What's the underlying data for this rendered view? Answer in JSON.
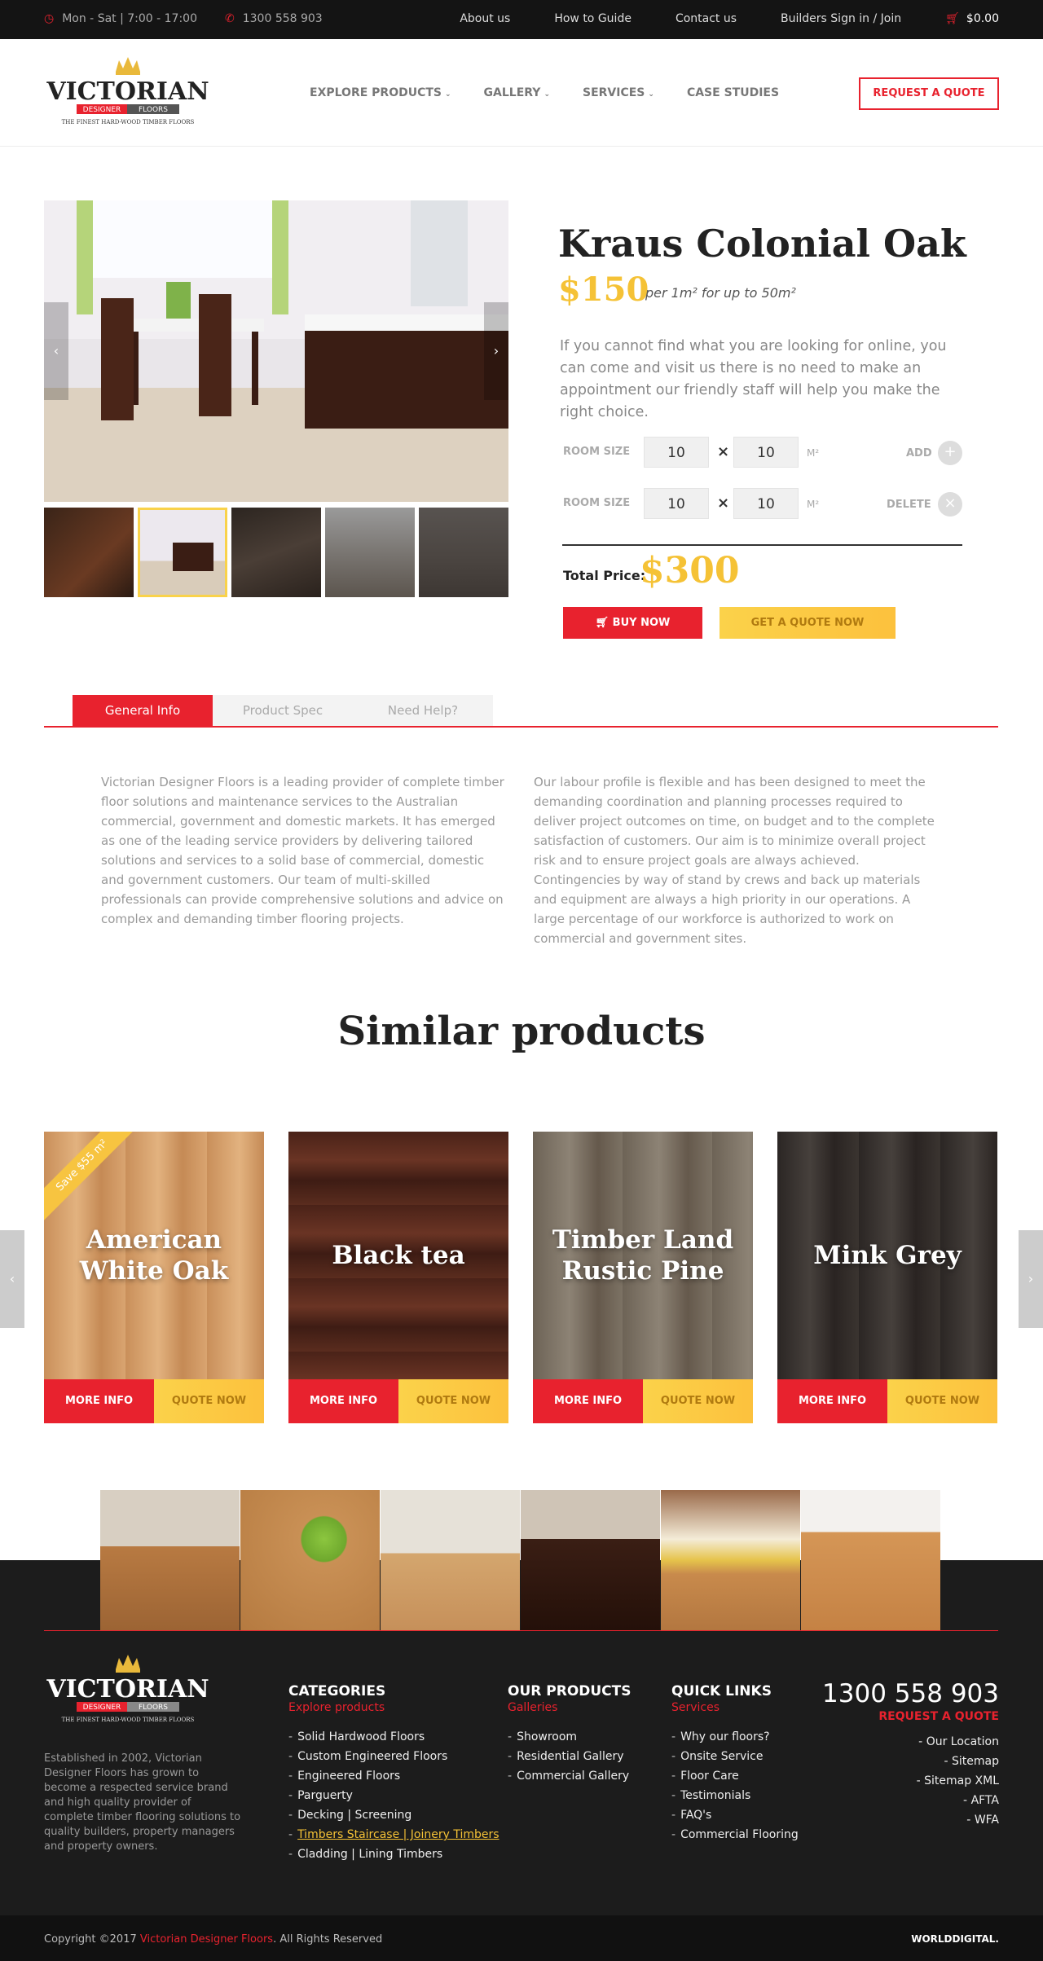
{
  "topbar": {
    "hours": "Mon - Sat | 7:00 - 17:00",
    "phone": "1300 558 903",
    "links": [
      "About us",
      "How to Guide",
      "Contact us",
      "Builders Sign in / Join"
    ],
    "cart": "$0.00"
  },
  "header": {
    "logo_main": "VICTORIAN",
    "logo_badge_a": "DESIGNER",
    "logo_badge_b": "FLOORS",
    "logo_tagline": "THE FINEST HARD-WOOD TIMBER FLOORS",
    "nav": [
      "EXPLORE PRODUCTS",
      "GALLERY",
      "SERVICES",
      "CASE STUDIES"
    ],
    "cta": "REQUEST A QUOTE"
  },
  "product": {
    "title": "Kraus Colonial Oak",
    "price": "$150",
    "per_unit": "per 1m² for up to 50m²",
    "description": "If you cannot find what you are looking for online, you can come and visit us there is no need to make an appointment our friendly staff will help you make the right choice.",
    "rows": [
      {
        "label": "ROOM SIZE",
        "a": "10",
        "b": "10",
        "unit": "M²",
        "action": "ADD",
        "symbol": "+"
      },
      {
        "label": "ROOM SIZE",
        "a": "10",
        "b": "10",
        "unit": "M²",
        "action": "DELETE",
        "symbol": "×"
      }
    ],
    "times": "×",
    "total_label": "Total Price:",
    "total": "$300",
    "buy": "BUY NOW",
    "quote": "GET A QUOTE NOW"
  },
  "tabs": [
    "General Info",
    "Product Spec",
    "Need Help?"
  ],
  "info": {
    "left": "Victorian Designer Floors is a leading provider of complete timber floor solutions and maintenance services to the Australian commercial, government and domestic markets. It has emerged as one of the leading service providers by delivering tailored solutions and services to a solid base of commercial, domestic and government customers. Our team of multi-skilled professionals can provide comprehensive solutions and advice on complex and demanding timber flooring projects.",
    "right": "Our labour profile is flexible and has been designed to meet the demanding coordination and planning processes required to deliver project outcomes on time, on budget and to the complete satisfaction of customers. Our aim is to minimize overall project risk and to ensure project goals are always achieved. Contingencies by way of stand by crews and back up materials and equipment are always a high priority in our operations. A large percentage of our workforce is authorized to work on commercial and government sites."
  },
  "similar": {
    "title": "Similar products",
    "ribbon": "Save $55 m²",
    "more": "MORE INFO",
    "quote": "QUOTE NOW",
    "cards": [
      {
        "name": "American White Oak",
        "color_a": "#c98f5a",
        "color_b": "#e2b27f"
      },
      {
        "name": "Black tea",
        "color_a": "#4a2218",
        "color_b": "#6a3424"
      },
      {
        "name": "Timber Land Rustic Pine",
        "color_a": "#6d6356",
        "color_b": "#8d8375"
      },
      {
        "name": "Mink Grey",
        "color_a": "#2b2624",
        "color_b": "#46403c"
      }
    ]
  },
  "footer": {
    "about": "Established in 2002, Victorian Designer Floors has grown to become a respected service brand and high quality provider of complete timber flooring solutions to quality builders, property managers and property owners.",
    "categories": {
      "title": "CATEGORIES",
      "sub": "Explore products",
      "items": [
        "Solid Hardwood Floors",
        "Custom Engineered Floors",
        "Engineered Floors",
        "Parguerty",
        "Decking | Screening",
        "Timbers Staircase | Joinery Timbers",
        "Cladding | Lining Timbers"
      ]
    },
    "products": {
      "title": "OUR PRODUCTS",
      "sub": "Galleries",
      "items": [
        "Showroom",
        "Residential Gallery",
        "Commercial Gallery"
      ]
    },
    "quick": {
      "title": "QUICK LINKS",
      "sub": "Services",
      "items": [
        "Why our floors?",
        "Onsite Service",
        "Floor Care",
        "Testimonials",
        "FAQ's",
        "Commercial Flooring"
      ]
    },
    "phone": "1300 558 903",
    "request": "REQUEST A QUOTE",
    "right_links": [
      "Our Location",
      "Sitemap",
      "Sitemap XML",
      "AFTA",
      "WFA"
    ],
    "copyright_pre": "Copyright ©2017 ",
    "copyright_brand": "Victorian Designer Floors",
    "copyright_post": ". All Rights Reserved",
    "credit": "WORLDDIGITAL."
  }
}
